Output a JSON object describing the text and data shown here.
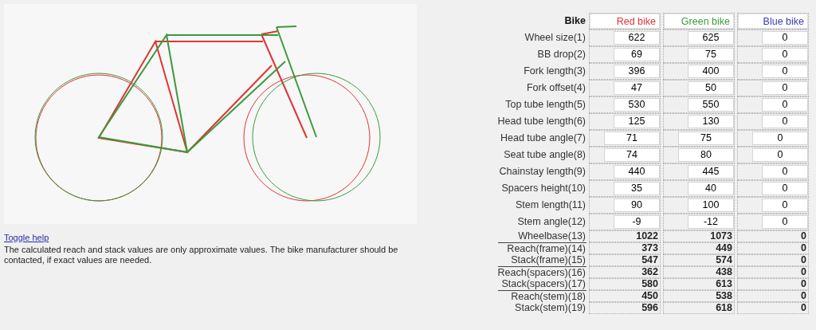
{
  "help": {
    "link": "Toggle help ",
    "text": "The calculated reach and stack values are only approximate values. The bike manufacturer should be contacted, if exact values are needed."
  },
  "table": {
    "header": "Bike",
    "bikes": [
      {
        "name": "Red bike",
        "color": "#e03434"
      },
      {
        "name": "Green bike",
        "color": "#3c9a3c"
      },
      {
        "name": "Blue bike",
        "color": "#3838b8"
      }
    ],
    "rows": [
      {
        "label": "Wheel size(1)",
        "kind": "input",
        "values": [
          "622",
          "625",
          "0"
        ]
      },
      {
        "label": "BB drop(2)",
        "kind": "input",
        "values": [
          "69",
          "75",
          "0"
        ]
      },
      {
        "label": "Fork length(3)",
        "kind": "input",
        "values": [
          "396",
          "400",
          "0"
        ]
      },
      {
        "label": "Fork offset(4)",
        "kind": "input",
        "values": [
          "47",
          "50",
          "0"
        ]
      },
      {
        "label": "Top tube length(5)",
        "kind": "input",
        "values": [
          "530",
          "550",
          "0"
        ]
      },
      {
        "label": "Head tube length(6)",
        "kind": "input",
        "values": [
          "125",
          "130",
          "0"
        ]
      },
      {
        "label": "Head tube angle(7)",
        "kind": "wide-input",
        "values": [
          "71",
          "75",
          "0"
        ]
      },
      {
        "label": "Seat tube angle(8)",
        "kind": "wide-input",
        "values": [
          "74",
          "80",
          "0"
        ]
      },
      {
        "label": "Chainstay length(9)",
        "kind": "input",
        "values": [
          "440",
          "445",
          "0"
        ]
      },
      {
        "label": "Spacers height(10)",
        "kind": "input",
        "values": [
          "35",
          "40",
          "0"
        ]
      },
      {
        "label": "Stem length(11)",
        "kind": "input",
        "values": [
          "90",
          "100",
          "0"
        ]
      },
      {
        "label": "Stem angle(12)",
        "kind": "input",
        "values": [
          "-9",
          "-12",
          "0"
        ]
      },
      {
        "label": "Wheelbase(13)",
        "kind": "result",
        "divider_before": false,
        "values": [
          "1022",
          "1073",
          "0"
        ]
      },
      {
        "label": "Reach(frame)(14)",
        "kind": "result",
        "divider_before": true,
        "values": [
          "373",
          "449",
          "0"
        ]
      },
      {
        "label": "Stack(frame)(15)",
        "kind": "result",
        "divider_before": false,
        "values": [
          "547",
          "574",
          "0"
        ]
      },
      {
        "label": "Reach(spacers)(16)",
        "kind": "result",
        "divider_before": true,
        "values": [
          "362",
          "438",
          "0"
        ]
      },
      {
        "label": "Stack(spacers)(17)",
        "kind": "result",
        "divider_before": false,
        "values": [
          "580",
          "613",
          "0"
        ]
      },
      {
        "label": "Reach(stem)(18)",
        "kind": "result",
        "divider_before": true,
        "values": [
          "450",
          "538",
          "0"
        ]
      },
      {
        "label": "Stack(stem)(19)",
        "kind": "result",
        "divider_before": false,
        "values": [
          "596",
          "618",
          "0"
        ]
      }
    ]
  }
}
